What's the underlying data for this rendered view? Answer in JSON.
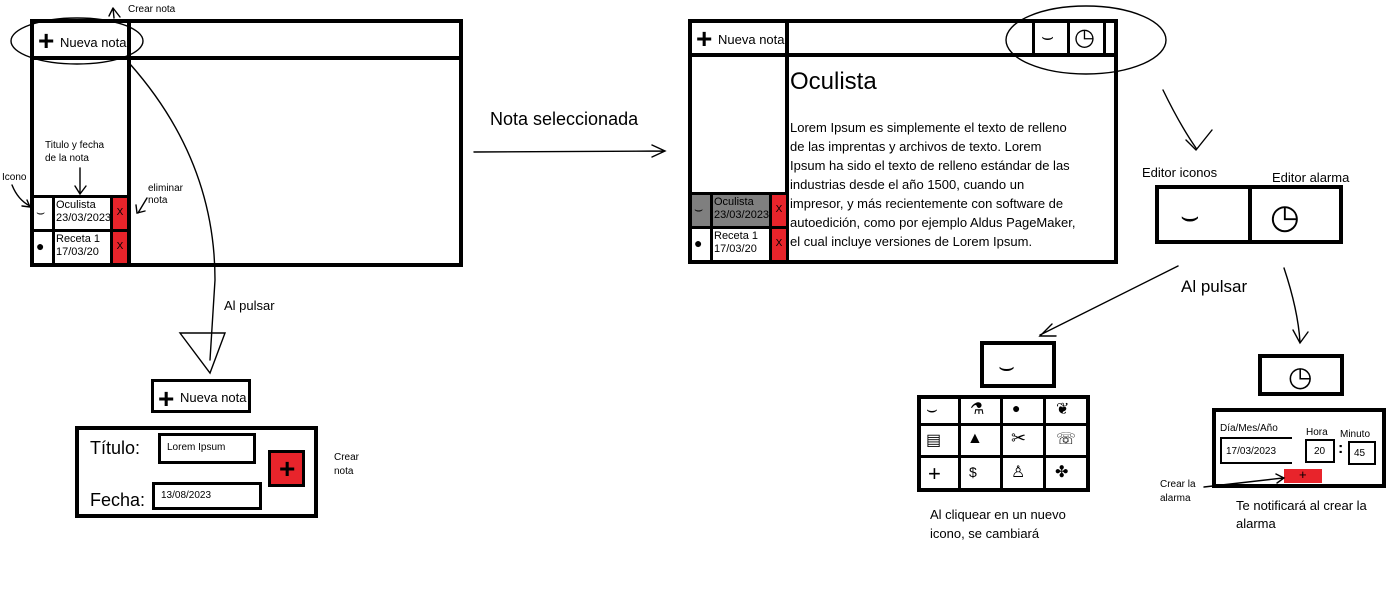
{
  "annotations": {
    "crear_nota_top": "Crear nota",
    "titulo_fecha": "Titulo y fecha",
    "de_la_nota": "de la nota",
    "icono": "Icono",
    "eliminar": "eliminar",
    "nota": "nota",
    "al_pulsar_left": "Al pulsar",
    "nota_seleccionada": "Nota seleccionada",
    "editor_iconos": "Editor iconos",
    "editor_alarma": "Editor alarma",
    "al_pulsar_right": "Al pulsar",
    "crear_nota_side_1": "Crear",
    "crear_nota_side_2": "nota",
    "al_cliquear_1": "Al cliquear en un nuevo",
    "al_cliquear_2": "icono, se cambiará",
    "crear_la": "Crear la",
    "alarma": "alarma",
    "te_notificara_1": "Te notificará al crear la",
    "te_notificara_2": "alarma"
  },
  "app_left": {
    "new_note_label": "Nueva nota",
    "notes": [
      {
        "title": "Oculista",
        "date": "23/03/2023",
        "delete": "X"
      },
      {
        "title": "Receta 1",
        "date": "17/03/20",
        "delete": "X"
      }
    ]
  },
  "app_right": {
    "new_note_label": "Nueva nota",
    "selected_title": "Oculista",
    "selected_date": "23/03/2023",
    "body": [
      "Lorem Ipsum es simplemente el texto de relleno",
      "de las imprentas y archivos de texto. Lorem",
      "Ipsum ha sido el texto de relleno estándar de las",
      "industrias desde el año 1500, cuando un",
      "impresor, y más recientemente con software de",
      "autoedición, como por ejemplo Aldus PageMaker,",
      "el cual incluye versiones de Lorem Ipsum."
    ],
    "notes": [
      {
        "title": "Oculista",
        "date": "23/03/2023",
        "delete": "X"
      },
      {
        "title": "Receta 1",
        "date": "17/03/20",
        "delete": "X"
      }
    ]
  },
  "create_form": {
    "new_note_label": "Nueva nota",
    "title_label": "Título:",
    "title_value": "Lorem Ipsum",
    "date_label": "Fecha:",
    "date_value": "13/08/2023"
  },
  "alarm_editor": {
    "date_label": "Día/Mes/Año",
    "date_value": "17/03/2023",
    "hour_label": "Hora",
    "hour_value": "20",
    "separator": ":",
    "minute_label": "Minuto",
    "minute_value": "45",
    "create_button": "+"
  },
  "colors": {
    "delete_red": "#e8242b",
    "selected_gray": "#7f7f7f"
  }
}
